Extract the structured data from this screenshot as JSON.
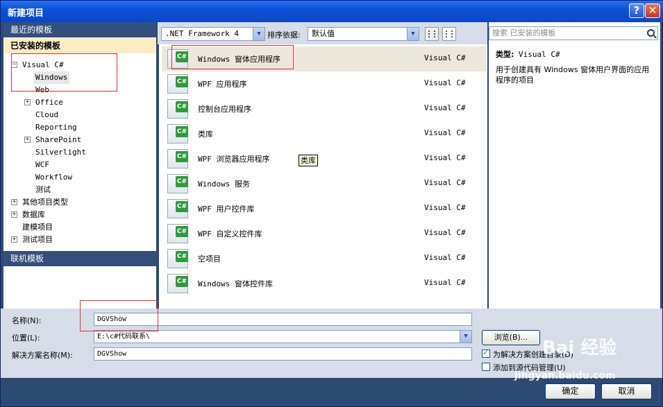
{
  "window": {
    "title": "新建项目",
    "help_glyph": "?",
    "close_glyph": "✕"
  },
  "left": {
    "recent_header": "最近的模板",
    "installed_header": "已安装的模板",
    "online_header": "联机模板",
    "tree": [
      {
        "label": "Visual C#",
        "expander": "−"
      },
      {
        "label": "Windows"
      },
      {
        "label": "Web"
      },
      {
        "label": "Office",
        "expander": "+"
      },
      {
        "label": "Cloud"
      },
      {
        "label": "Reporting"
      },
      {
        "label": "SharePoint",
        "expander": "+"
      },
      {
        "label": "Silverlight"
      },
      {
        "label": "WCF"
      },
      {
        "label": "Workflow"
      },
      {
        "label": "测试"
      },
      {
        "label": "其他项目类型",
        "expander": "+"
      },
      {
        "label": "数据库",
        "expander": "+"
      },
      {
        "label": "建模项目"
      },
      {
        "label": "测试项目",
        "expander": "+"
      }
    ]
  },
  "toolbar": {
    "framework": ".NET Framework 4",
    "sort_label": "排序依据:",
    "sort_value": "默认值",
    "search_placeholder": "搜索 已安装的模板"
  },
  "templates": [
    {
      "name": "Windows 窗体应用程序",
      "lang": "Visual C#"
    },
    {
      "name": "WPF 应用程序",
      "lang": "Visual C#"
    },
    {
      "name": "控制台应用程序",
      "lang": "Visual C#"
    },
    {
      "name": "类库",
      "lang": "Visual C#"
    },
    {
      "name": "WPF 浏览器应用程序",
      "lang": "Visual C#"
    },
    {
      "name": "Windows 服务",
      "lang": "Visual C#"
    },
    {
      "name": "WPF 用户控件库",
      "lang": "Visual C#"
    },
    {
      "name": "WPF 自定义控件库",
      "lang": "Visual C#"
    },
    {
      "name": "空项目",
      "lang": "Visual C#"
    },
    {
      "name": "Windows 窗体控件库",
      "lang": "Visual C#"
    }
  ],
  "icon_badge": "C#",
  "tooltip": "类库",
  "description": {
    "type_label": "类型:",
    "type_value": "Visual C#",
    "text": "用于创建具有 Windows 窗体用户界面的应用程序的项目"
  },
  "form": {
    "name_label": "名称(N):",
    "name_value": "DGVShow",
    "location_label": "位置(L):",
    "location_value": "E:\\c#代码联系\\",
    "solution_label": "解决方案名称(M):",
    "solution_value": "DGVShow",
    "browse_label": "浏览(B)...",
    "create_dir_label": "为解决方案创建目录(D)",
    "add_source_label": "添加到源代码管理(U)"
  },
  "buttons": {
    "ok": "确定",
    "cancel": "取消"
  },
  "watermark": {
    "brand": "Bai 经验",
    "url": "jingyan.baidu.com"
  },
  "colors": {
    "title_bar": "#0a52d6",
    "section_header": "#33507d",
    "selected_section": "#fbeec4",
    "highlight_box": "#e03030"
  }
}
